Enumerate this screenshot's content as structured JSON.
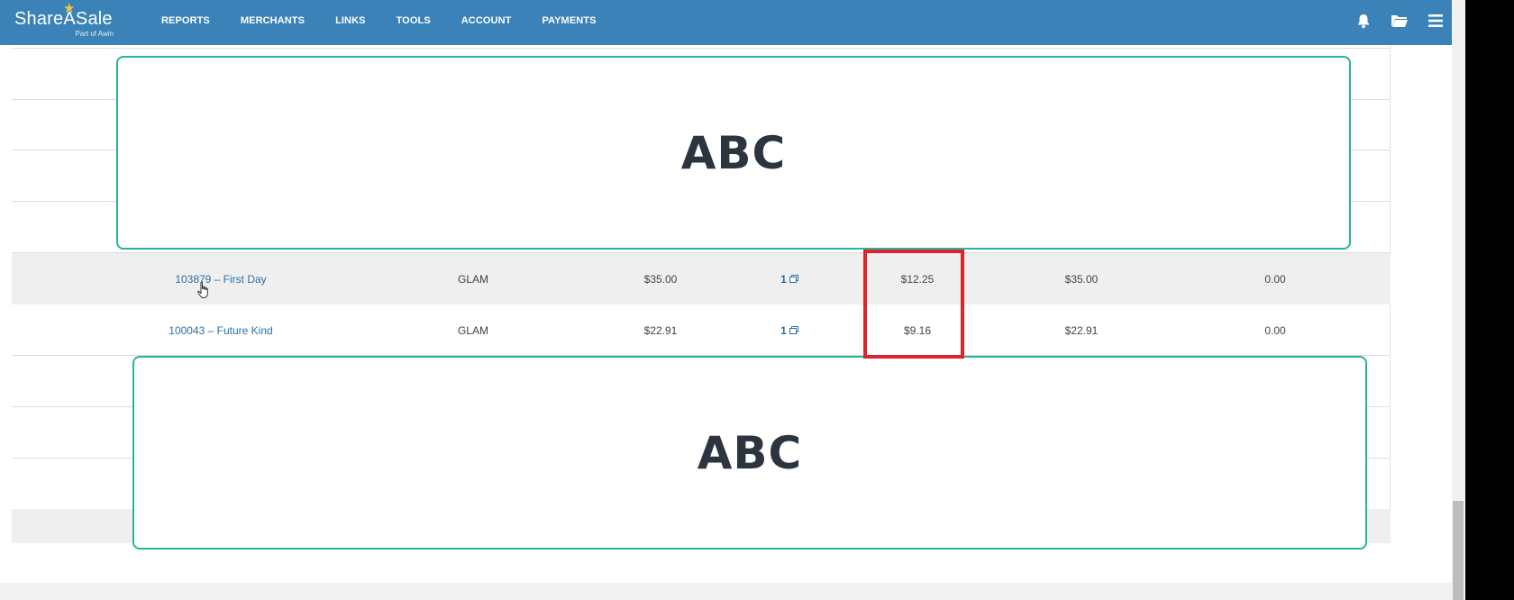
{
  "header": {
    "logo_text": "ShareASale",
    "logo_sub": "Part of Awin",
    "nav": [
      "REPORTS",
      "MERCHANTS",
      "LINKS",
      "TOOLS",
      "ACCOUNT",
      "PAYMENTS"
    ],
    "icons": [
      "bell-icon",
      "folder-icon",
      "menu-icon"
    ]
  },
  "redactions": [
    "ABC",
    "ABC"
  ],
  "table": {
    "rows": [
      {
        "merchant": "103879 – First Day",
        "tier": "GLAM",
        "sale_amount": "$35.00",
        "count": "1",
        "commission": "$12.25",
        "total": "$35.00",
        "other": "0.00"
      },
      {
        "merchant": "100043 – Future Kind",
        "tier": "GLAM",
        "sale_amount": "$22.91",
        "count": "1",
        "commission": "$9.16",
        "total": "$22.91",
        "other": "0.00"
      }
    ]
  },
  "colors": {
    "header_bg": "#3a82b7",
    "redaction_border": "#2bb39a",
    "highlight": "#e0222c",
    "link": "#2f6ea5"
  }
}
